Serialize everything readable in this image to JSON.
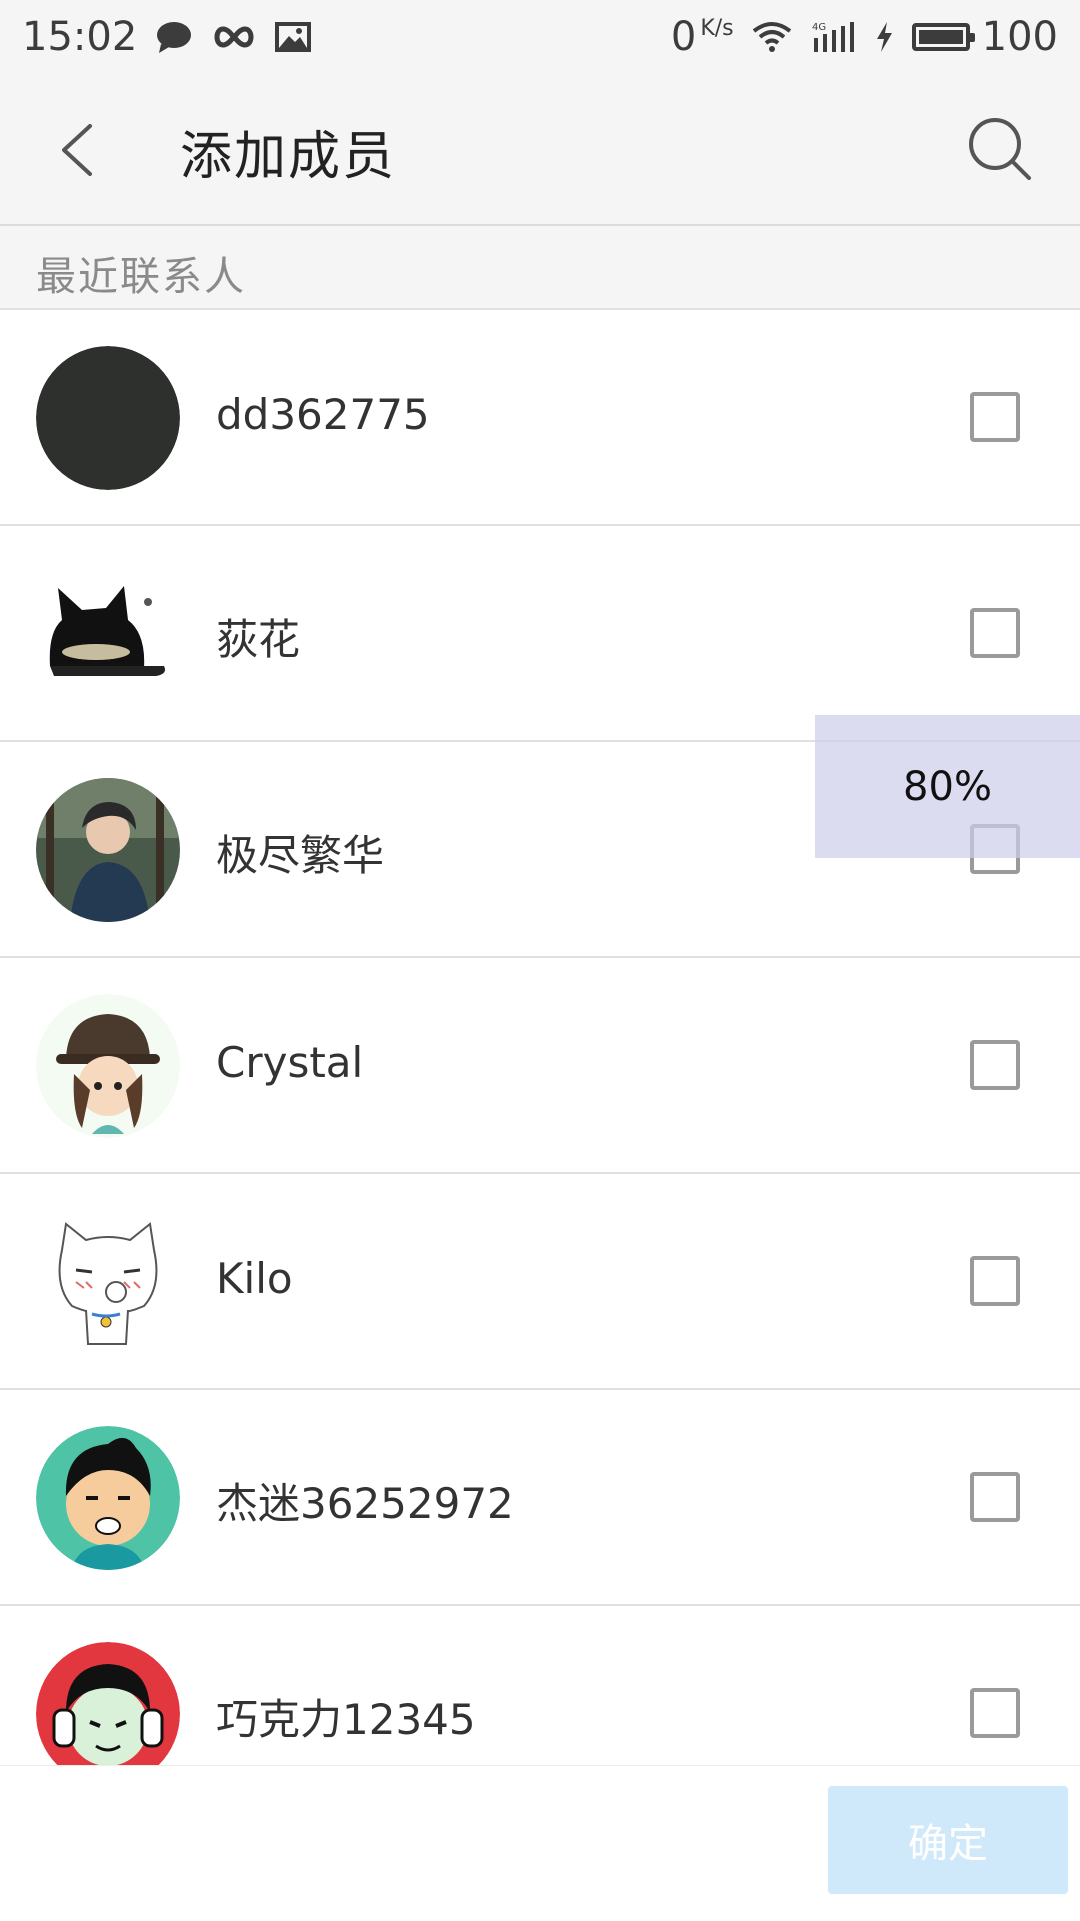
{
  "status_bar": {
    "time": "15:02",
    "net_speed": "0",
    "net_speed_unit": "K/s",
    "battery_level": "100",
    "icons": [
      "message-icon",
      "infinity-icon",
      "image-icon",
      "wifi-icon",
      "signal-4g-icon",
      "charging-icon",
      "battery-icon"
    ]
  },
  "header": {
    "title": "添加成员",
    "back_icon": "chevron-left-icon",
    "search_icon": "search-icon"
  },
  "section": {
    "title": "最近联系人"
  },
  "contacts": [
    {
      "name": "dd362775",
      "checked": false,
      "avatar": "dark-avatar"
    },
    {
      "name": "荻花",
      "checked": false,
      "avatar": "black-cat-avatar"
    },
    {
      "name": "极尽繁华",
      "checked": false,
      "avatar": "photo-avatar"
    },
    {
      "name": "Crystal",
      "checked": false,
      "avatar": "girl-hat-avatar"
    },
    {
      "name": "Kilo",
      "checked": false,
      "avatar": "white-cat-avatar"
    },
    {
      "name": "杰迷36252972",
      "checked": false,
      "avatar": "cartoon-boy-avatar"
    },
    {
      "name": "巧克力12345",
      "checked": false,
      "avatar": "headphones-avatar"
    }
  ],
  "overlay": {
    "progress_label": "80%"
  },
  "footer": {
    "confirm_label": "确定"
  },
  "colors": {
    "bar_background": "#f5f5f5",
    "confirm_button": "#cfe9fb",
    "overlay": "#cdcdeb"
  }
}
